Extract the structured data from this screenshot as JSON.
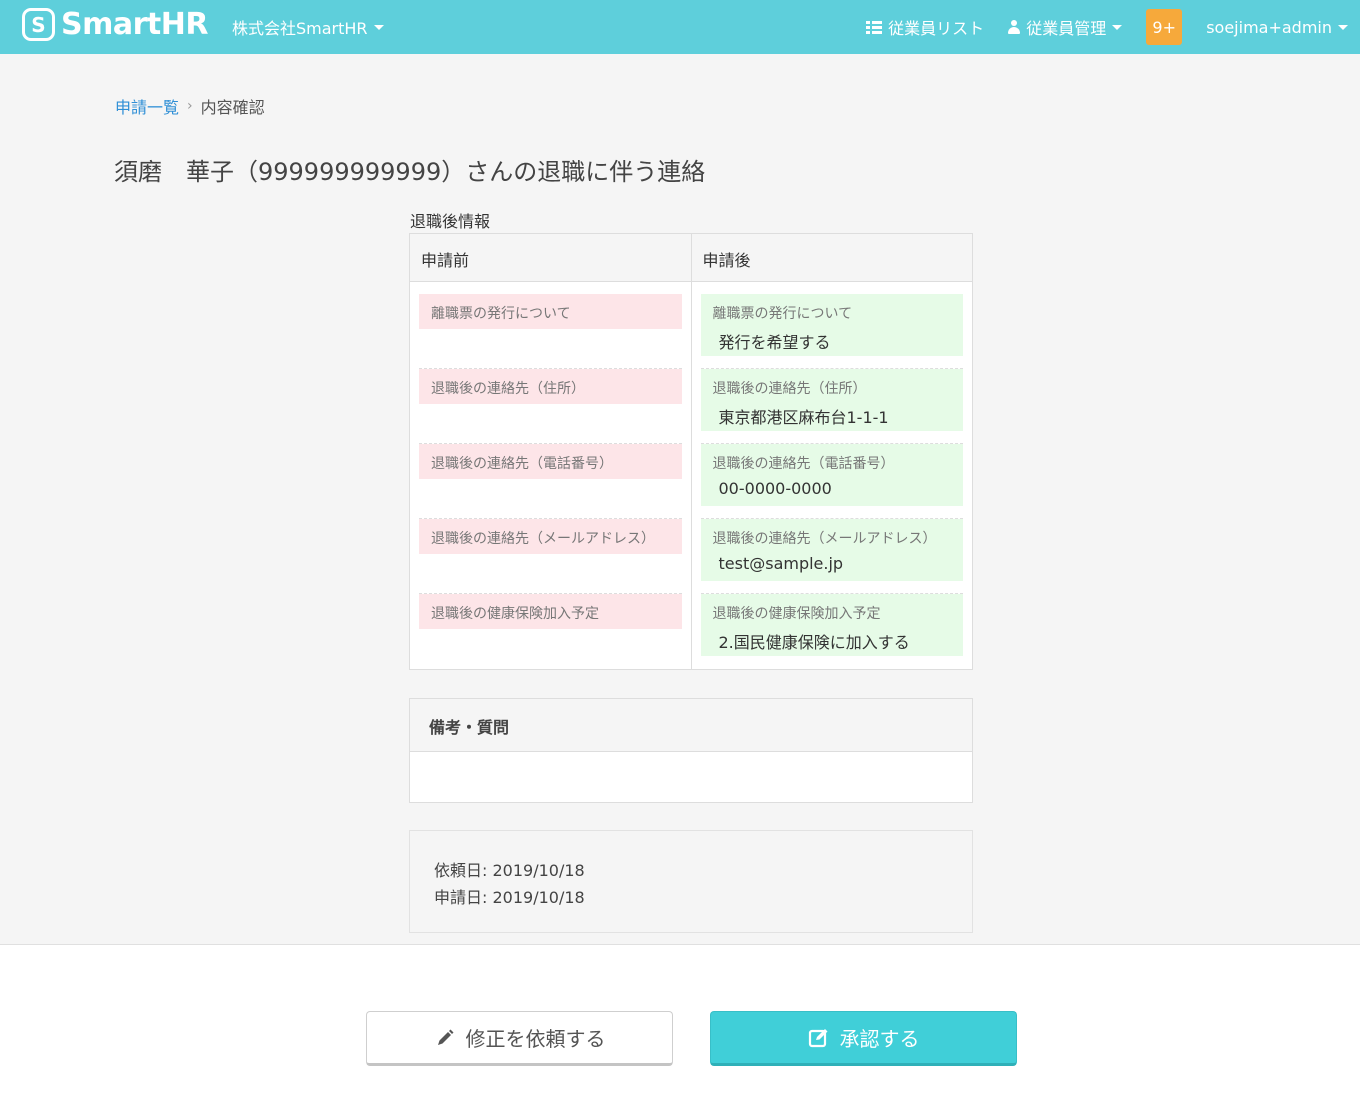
{
  "header": {
    "logo_mark": "S",
    "logo_text": "SmartHR",
    "company": "株式会社SmartHR",
    "nav_employee_list": "従業員リスト",
    "nav_employee_mgmt": "従業員管理",
    "notifications": "9+",
    "user": "soejima+admin"
  },
  "breadcrumb": {
    "parent": "申請一覧",
    "separator": "›",
    "current": "内容確認"
  },
  "page_title": "須磨　華子（999999999999）さんの退職に伴う連絡",
  "section_label": "退職後情報",
  "compare": {
    "before_header": "申請前",
    "after_header": "申請後",
    "rows": [
      {
        "label": "離職票の発行について",
        "after_value": "発行を希望する"
      },
      {
        "label": "退職後の連絡先（住所）",
        "after_value": "東京都港区麻布台1-1-1"
      },
      {
        "label": "退職後の連絡先（電話番号）",
        "after_value": "00-0000-0000"
      },
      {
        "label": "退職後の連絡先（メールアドレス）",
        "after_value": "test@sample.jp"
      },
      {
        "label": "退職後の健康保険加入予定",
        "after_value": "2.国民健康保険に加入する"
      }
    ]
  },
  "notes": {
    "title": "備考・質問"
  },
  "dates": {
    "requested": "依頼日: 2019/10/18",
    "applied": "申請日: 2019/10/18"
  },
  "actions": {
    "revise": "修正を依頼する",
    "approve": "承認する"
  },
  "colors": {
    "header": "#5ecfdb",
    "approve": "#40cfd8",
    "badge": "#f6a93b",
    "before_bg": "#fde5e8",
    "after_bg": "#e6fbe7"
  }
}
